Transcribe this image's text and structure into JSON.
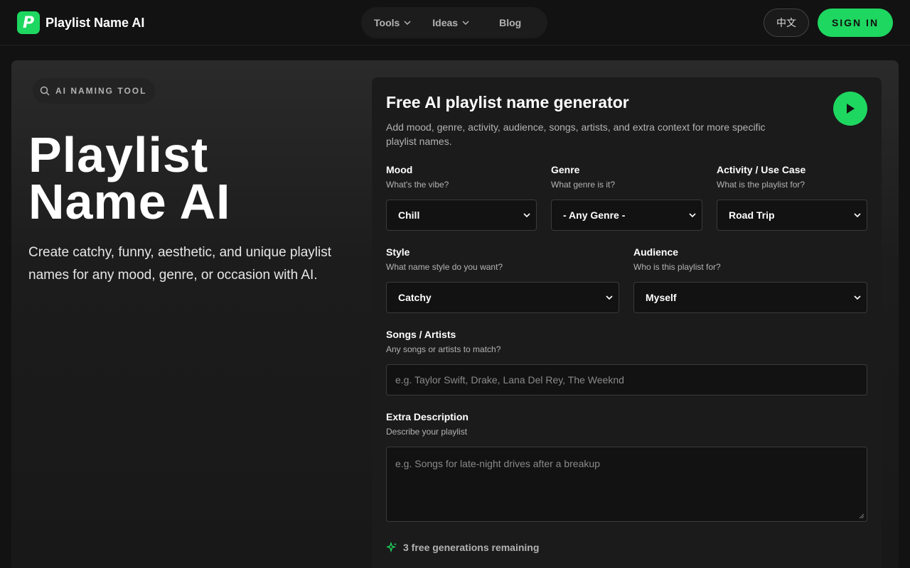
{
  "header": {
    "logo_letter": "P",
    "app_title": "Playlist Name AI",
    "nav": [
      {
        "label": "Tools",
        "has_dropdown": true
      },
      {
        "label": "Ideas",
        "has_dropdown": true
      },
      {
        "label": "Blog",
        "has_dropdown": false
      }
    ],
    "lang_label": "中文",
    "signin_label": "SIGN IN"
  },
  "hero": {
    "badge": "AI NAMING TOOL",
    "title_line1": "Playlist",
    "title_line2": "Name AI",
    "description": "Create catchy, funny, aesthetic, and unique playlist names for any mood, genre, or occasion with AI."
  },
  "form": {
    "title": "Free AI playlist name generator",
    "subtitle": "Add mood, genre, activity, audience, songs, artists, and extra context for more specific playlist names.",
    "mood": {
      "label": "Mood",
      "hint": "What's the vibe?",
      "value": "Chill"
    },
    "genre": {
      "label": "Genre",
      "hint": "What genre is it?",
      "value": "- Any Genre -"
    },
    "activity": {
      "label": "Activity / Use Case",
      "hint": "What is the playlist for?",
      "value": "Road Trip"
    },
    "style": {
      "label": "Style",
      "hint": "What name style do you want?",
      "value": "Catchy"
    },
    "audience": {
      "label": "Audience",
      "hint": "Who is this playlist for?",
      "value": "Myself"
    },
    "songs": {
      "label": "Songs / Artists",
      "hint": "Any songs or artists to match?",
      "placeholder": "e.g. Taylor Swift, Drake, Lana Del Rey, The Weeknd"
    },
    "extra": {
      "label": "Extra Description",
      "hint": "Describe your playlist",
      "placeholder": "e.g. Songs for late-night drives after a breakup"
    },
    "remaining": "3 free generations remaining"
  },
  "colors": {
    "accent": "#1ed760",
    "background": "#121212",
    "card": "#1b1b1b"
  }
}
